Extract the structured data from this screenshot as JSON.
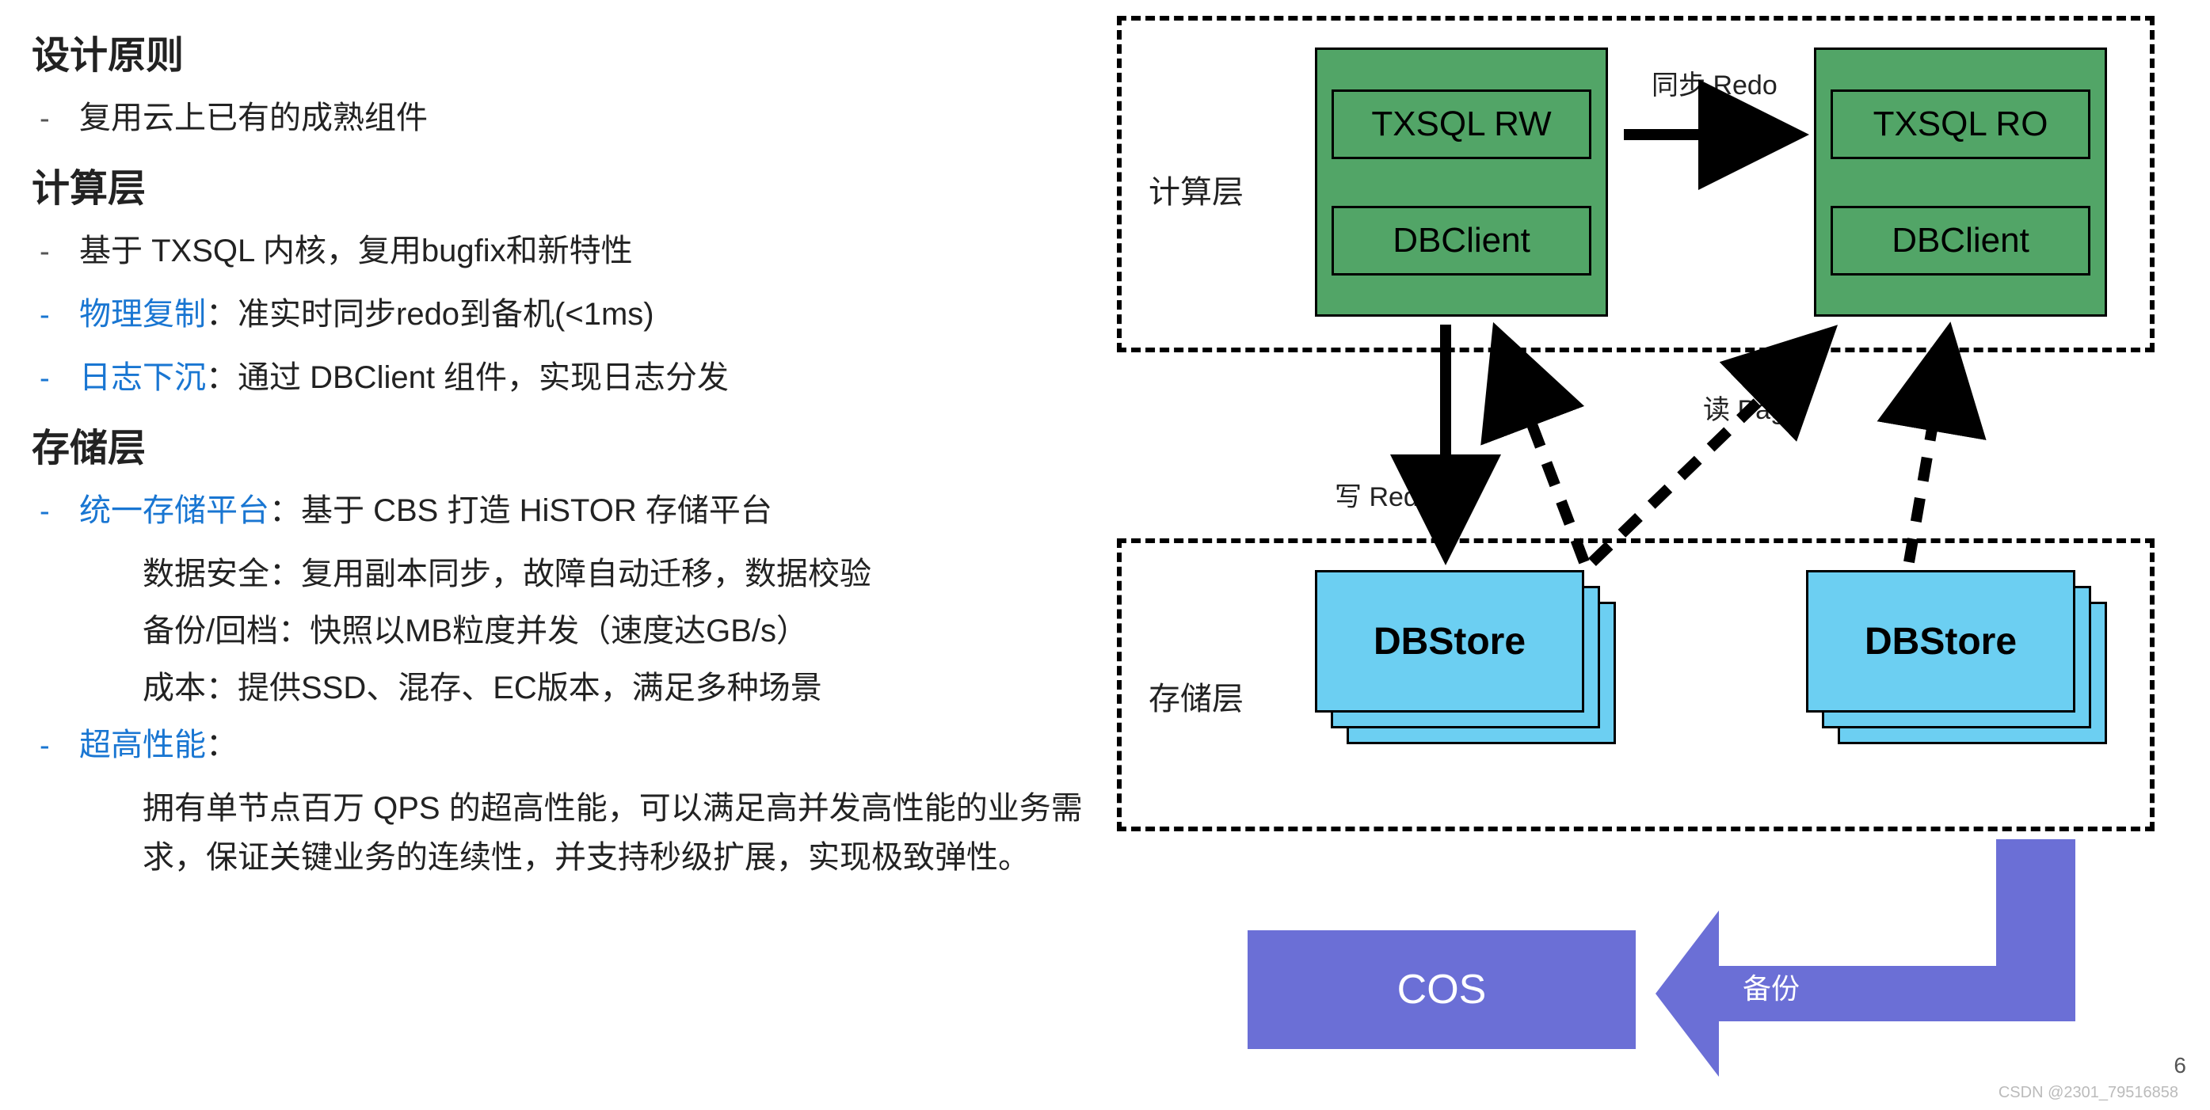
{
  "headings": {
    "design": "设计原则",
    "compute": "计算层",
    "storage": "存储层"
  },
  "bullets": {
    "design1": "复用云上已有的成熟组件",
    "compute1": "基于 TXSQL 内核，复用bugfix和新特性",
    "compute2_blue": "物理复制",
    "compute2_rest": "：准实时同步redo到备机(<1ms)",
    "compute3_blue": "日志下沉",
    "compute3_rest": "：通过 DBClient 组件，实现日志分发",
    "storage1_blue": "统一存储平台",
    "storage1_rest": "：基于 CBS 打造 HiSTOR 存储平台",
    "storage1a": "数据安全：复用副本同步，故障自动迁移，数据校验",
    "storage1b": "备份/回档：快照以MB粒度并发（速度达GB/s）",
    "storage1c": "成本：提供SSD、混存、EC版本，满足多种场景",
    "storage2_blue": "超高性能",
    "storage2_rest": "：",
    "storage2a": "拥有单节点百万 QPS 的超高性能，可以满足高并发高性能的业务需求，保证关键业务的连续性，并支持秒级扩展，实现极致弹性。"
  },
  "diagram": {
    "compute_layer_label": "计算层",
    "storage_layer_label": "存储层",
    "txsql_rw": "TXSQL RW",
    "txsql_ro": "TXSQL RO",
    "dbclient": "DBClient",
    "dbstore": "DBStore",
    "cos": "COS",
    "sync_redo": "同步 Redo",
    "write_redo": "写 Redo",
    "read_page": "读 Page",
    "backup": "备份"
  },
  "page_number": "6",
  "watermark": "CSDN @2301_79516858"
}
